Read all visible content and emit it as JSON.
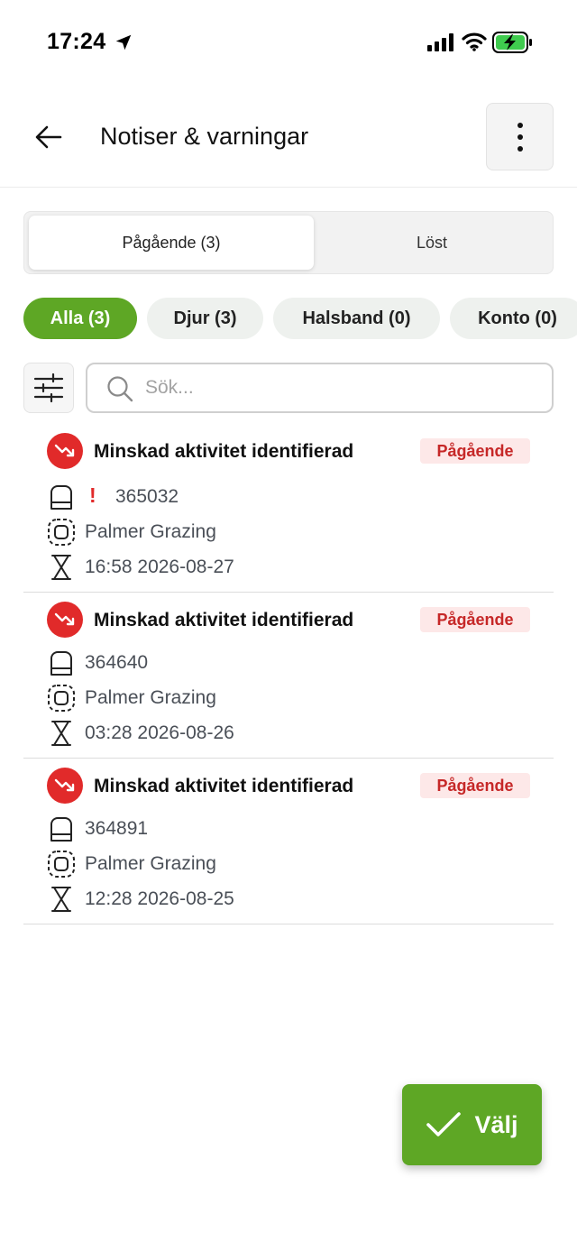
{
  "status_bar": {
    "time": "17:24"
  },
  "header": {
    "title": "Notiser & varningar"
  },
  "tabs": [
    {
      "label": "Pågående (3)",
      "active": true
    },
    {
      "label": "Löst",
      "active": false
    }
  ],
  "chips": [
    {
      "label": "Alla (3)",
      "active": true
    },
    {
      "label": "Djur (3)",
      "active": false
    },
    {
      "label": "Halsband (0)",
      "active": false
    },
    {
      "label": "Konto (0)",
      "active": false
    }
  ],
  "search": {
    "placeholder": "Sök..."
  },
  "alerts": [
    {
      "icon": "trending-down-icon",
      "title": "Minskad aktivitet identifierad",
      "status": "Pågående",
      "collar_id": "365032",
      "warning": "!",
      "location": "Palmer Grazing",
      "timestamp": "16:58 2026-08-27"
    },
    {
      "icon": "trending-down-icon",
      "title": "Minskad aktivitet identifierad",
      "status": "Pågående",
      "collar_id": "364640",
      "location": "Palmer Grazing",
      "timestamp": "03:28 2026-08-26"
    },
    {
      "icon": "trending-down-icon",
      "title": "Minskad aktivitet identifierad",
      "status": "Pågående",
      "collar_id": "364891",
      "location": "Palmer Grazing",
      "timestamp": "12:28 2026-08-25"
    }
  ],
  "fab": {
    "label": "Välj"
  },
  "colors": {
    "accent": "#5ea725",
    "alert": "#e12a2a",
    "badge_bg": "#fde8e8",
    "badge_text": "#c62828"
  }
}
